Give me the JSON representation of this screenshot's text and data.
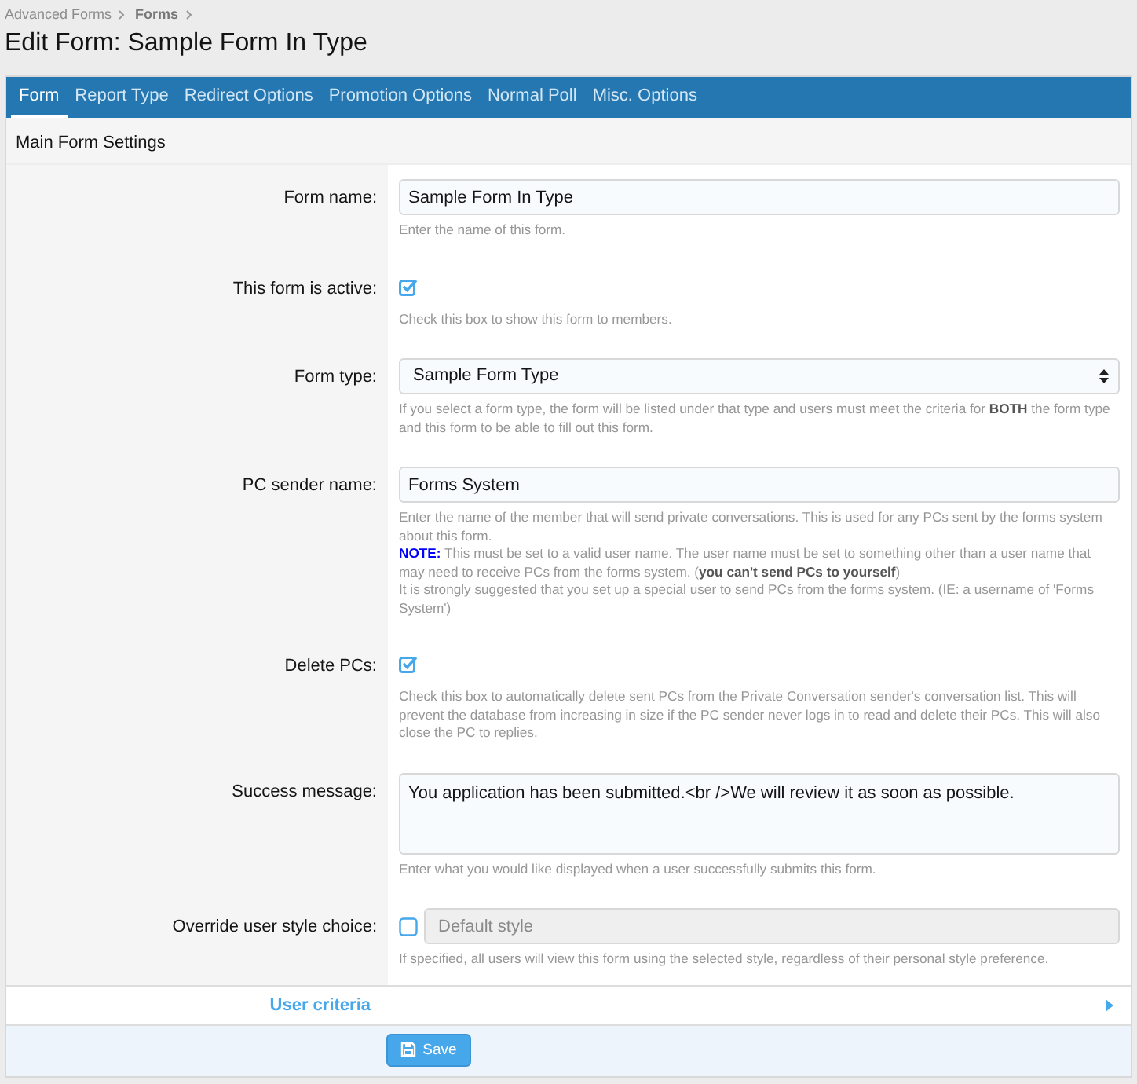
{
  "breadcrumb": [
    {
      "label": "Advanced Forms",
      "current": false
    },
    {
      "label": "Forms",
      "current": true
    }
  ],
  "title": "Edit Form: Sample Form In Type",
  "tabs": [
    {
      "label": "Form",
      "selected": true
    },
    {
      "label": "Report Type",
      "selected": false
    },
    {
      "label": "Redirect Options",
      "selected": false
    },
    {
      "label": "Promotion Options",
      "selected": false
    },
    {
      "label": "Normal Poll",
      "selected": false
    },
    {
      "label": "Misc. Options",
      "selected": false
    }
  ],
  "section_title": "Main Form Settings",
  "rows": [
    {
      "kind": "text",
      "label": "Form name:",
      "value": "Sample Form In Type",
      "hints": [
        "Enter the name of this form."
      ]
    },
    {
      "kind": "checkbox",
      "label": "This form is active:",
      "checked": true,
      "hints": [
        "Check this box to show this form to members."
      ]
    },
    {
      "kind": "select",
      "label": "Form type:",
      "value": "Sample Form Type",
      "hints": [
        "If you select a form type, the form will be listed under that type and users must meet the criteria for **BOTH** the form type and this form to be able to fill out this form."
      ]
    },
    {
      "kind": "text",
      "label": "PC sender name:",
      "value": "Forms System",
      "hints": [
        "Enter the name of the member that will send private conversations. This is used for any PCs sent by the forms system about this form."
      ],
      "note": {
        "label": "NOTE:",
        "text": "This must be set to a valid user name. The user name must be set to something other than a user name that may need to receive PCs from the forms system. (**you can't send PCs to yourself**)"
      },
      "extra_hints": [
        "It is strongly suggested that you set up a special user to send PCs from the forms system. (IE: a username of 'Forms System')"
      ]
    },
    {
      "kind": "checkbox",
      "label": "Delete PCs:",
      "checked": true,
      "hints": [
        "Check this box to automatically delete sent PCs from the Private Conversation sender's conversation list. This will prevent the database from increasing in size if the PC sender never logs in to read and delete their PCs. This will also close the PC to replies."
      ]
    },
    {
      "kind": "textarea",
      "label": "Success message:",
      "value": "You application has been submitted.<br />We will review it as soon as possible.",
      "hints": [
        "Enter what you would like displayed when a user successfully submits this form."
      ]
    },
    {
      "kind": "style",
      "label": "Override user style choice:",
      "checked": false,
      "value": "Default style",
      "hints": [
        "If specified, all users will view this form using the selected style, regardless of their personal style preference."
      ]
    }
  ],
  "collapsible": {
    "label": "User criteria",
    "expanded": false
  },
  "save_button": "Save"
}
